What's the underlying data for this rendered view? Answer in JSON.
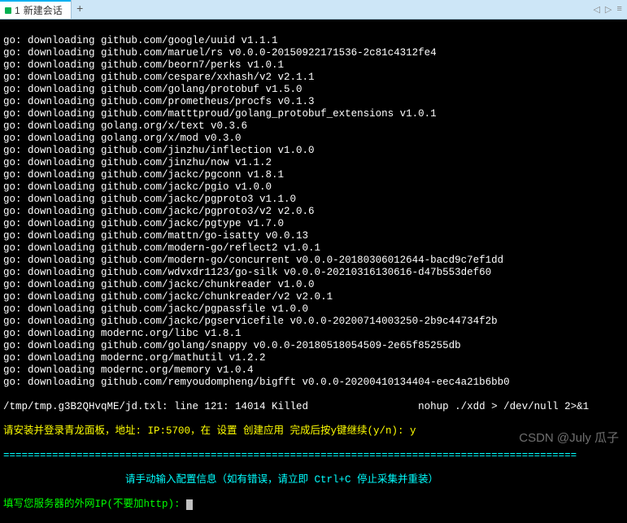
{
  "tabs": {
    "active": {
      "index": "1",
      "title": "新建会话"
    },
    "add_label": "+",
    "nav_left": "◁",
    "nav_right": "▷",
    "nav_menu": "≡"
  },
  "terminal": {
    "lines": [
      "go: downloading github.com/google/uuid v1.1.1",
      "go: downloading github.com/maruel/rs v0.0.0-20150922171536-2c81c4312fe4",
      "go: downloading github.com/beorn7/perks v1.0.1",
      "go: downloading github.com/cespare/xxhash/v2 v2.1.1",
      "go: downloading github.com/golang/protobuf v1.5.0",
      "go: downloading github.com/prometheus/procfs v0.1.3",
      "go: downloading github.com/matttproud/golang_protobuf_extensions v1.0.1",
      "go: downloading golang.org/x/text v0.3.6",
      "go: downloading golang.org/x/mod v0.3.0",
      "go: downloading github.com/jinzhu/inflection v1.0.0",
      "go: downloading github.com/jinzhu/now v1.1.2",
      "go: downloading github.com/jackc/pgconn v1.8.1",
      "go: downloading github.com/jackc/pgio v1.0.0",
      "go: downloading github.com/jackc/pgproto3 v1.1.0",
      "go: downloading github.com/jackc/pgproto3/v2 v2.0.6",
      "go: downloading github.com/jackc/pgtype v1.7.0",
      "go: downloading github.com/mattn/go-isatty v0.0.13",
      "go: downloading github.com/modern-go/reflect2 v1.0.1",
      "go: downloading github.com/modern-go/concurrent v0.0.0-20180306012644-bacd9c7ef1dd",
      "go: downloading github.com/wdvxdr1123/go-silk v0.0.0-20210316130616-d47b553def60",
      "go: downloading github.com/jackc/chunkreader v1.0.0",
      "go: downloading github.com/jackc/chunkreader/v2 v2.0.1",
      "go: downloading github.com/jackc/pgpassfile v1.0.0",
      "go: downloading github.com/jackc/pgservicefile v0.0.0-20200714003250-2b9c44734f2b",
      "go: downloading modernc.org/libc v1.8.1",
      "go: downloading github.com/golang/snappy v0.0.0-20180518054509-2e65f85255db",
      "go: downloading modernc.org/mathutil v1.2.2",
      "go: downloading modernc.org/memory v1.0.4",
      "go: downloading github.com/remyoudompheng/bigfft v0.0.0-20200410134404-eec4a21b6bb0"
    ],
    "killed_line": "/tmp/tmp.g3B2QHvqME/jd.txl: line 121: 14014 Killed                  nohup ./xdd > /dev/null 2>&1",
    "install_prompt": "请安装并登录青龙面板，地址: IP:5700，在 设置 创建应用 完成后按y键继续(y/n): y",
    "divider_line": "==============================================================================================",
    "manual_prompt_left": "                    请手动输入配置信息（如有错误，请立即 Ctrl+C 停止采集并重装）",
    "fill_prompt": "填写您服务器的外网IP(不要加http): "
  },
  "watermark": "CSDN @July 瓜子"
}
